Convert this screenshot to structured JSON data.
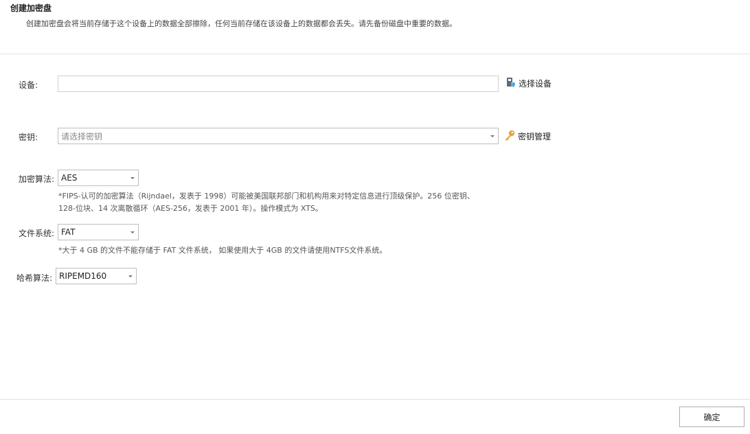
{
  "header": {
    "title": "创建加密盘",
    "description": "创建加密盘会将当前存储于这个设备上的数据全部擦除，任何当前存储在该设备上的数据都会丢失。请先备份磁盘中重要的数据。"
  },
  "form": {
    "device": {
      "label": "设备:",
      "value": "",
      "select_button": "选择设备",
      "icon": "usb-drive-shield-icon"
    },
    "key": {
      "label": "密钥:",
      "placeholder": "请选择密钥",
      "manage_button": "密钥管理",
      "icon": "key-icon"
    },
    "encryption": {
      "label": "加密算法:",
      "selected": "AES",
      "note_line1": "*FIPS-认可的加密算法（Rijndael，发表于 1998）可能被美国联邦部门和机构用来对特定信息进行顶级保护。256 位密钥、",
      "note_line2": "128-位块、14 次离散循环（AES-256，发表于 2001 年）。操作模式为 XTS。"
    },
    "filesystem": {
      "label": "文件系统:",
      "selected": "FAT",
      "note": "*大于 4 GB 的文件不能存储于 FAT 文件系统， 如果使用大于 4GB 的文件请使用NTFS文件系统。"
    },
    "hash": {
      "label": "哈希算法:",
      "selected": "RIPEMD160"
    }
  },
  "footer": {
    "ok_label": "确定"
  },
  "colors": {
    "key_icon": "#e8a33d",
    "drive_icon": "#5a6b7d",
    "shield_icon": "#3ba7d6",
    "divider": "#e3e3e3"
  }
}
